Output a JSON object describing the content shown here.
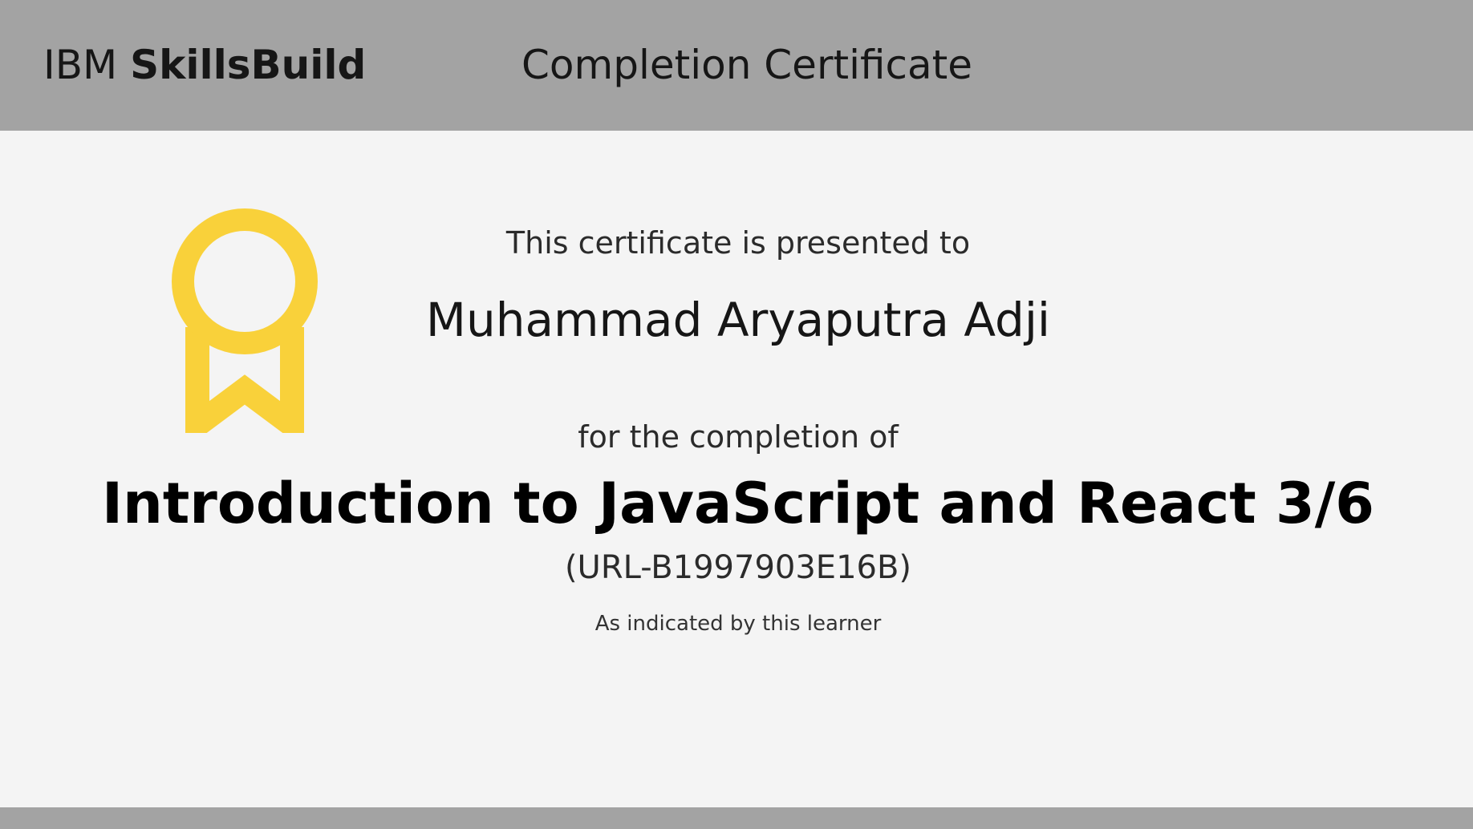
{
  "header": {
    "brand_ibm": "IBM",
    "brand_product": "SkillsBuild",
    "title": "Completion Certificate"
  },
  "certificate": {
    "presented_to_label": "This certificate is presented to",
    "recipient_name": "Muhammad Aryaputra Adji",
    "completion_label": "for the completion of",
    "course_title": "Introduction to JavaScript and React 3/6",
    "course_id": "(URL-B1997903E16B)",
    "note": "As indicated by this learner"
  },
  "icons": {
    "badge": "medal-ribbon-icon"
  },
  "colors": {
    "header_background": "#a3a3a3",
    "page_background": "#f4f4f4",
    "medal": "#f9d13a",
    "text": "#161616"
  }
}
